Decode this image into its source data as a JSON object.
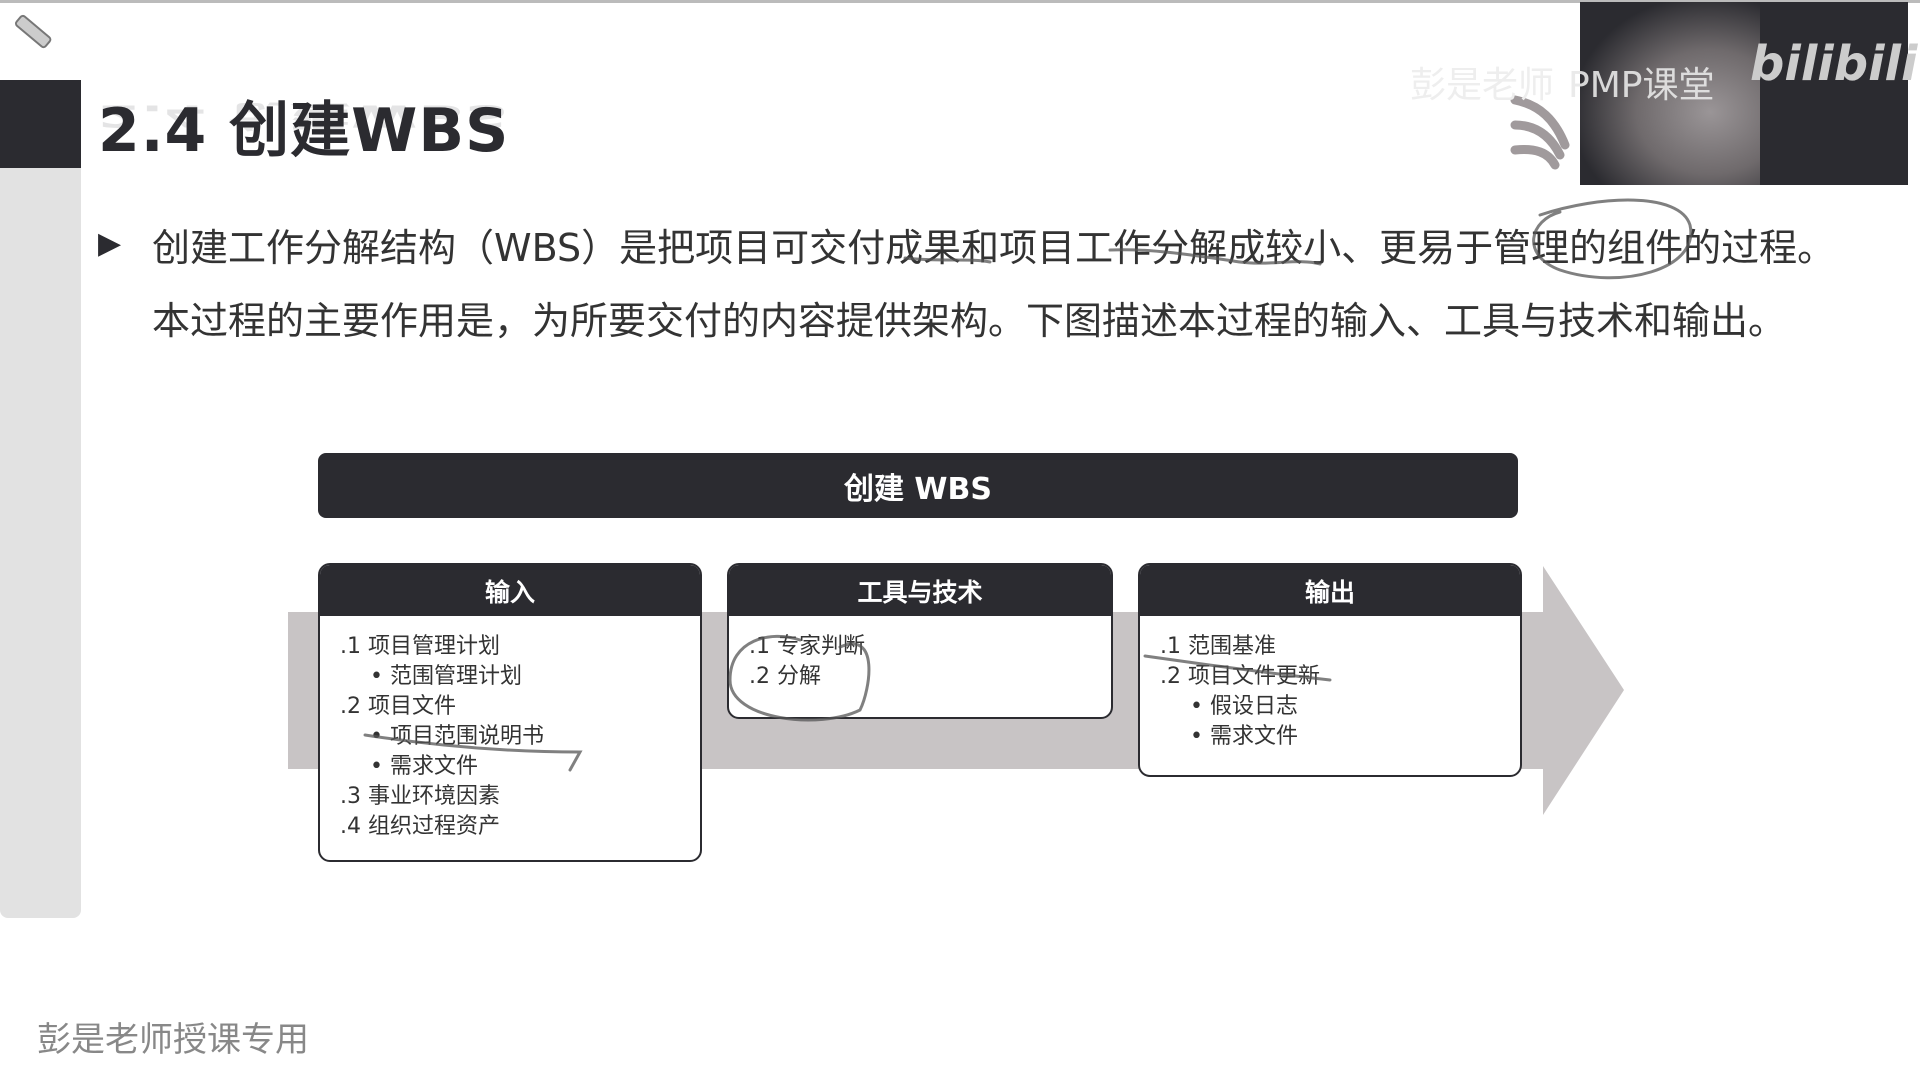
{
  "slide": {
    "title": "2.4 创建WBS",
    "paragraph": "创建工作分解结构（WBS）是把项目可交付成果和项目工作分解成较小、更易于管理的组件的过程。本过程的主要作用是，为所要交付的内容提供架构。下图描述本过程的输入、工具与技术和输出。",
    "bullet_icon": "play-triangle-icon",
    "diagram": {
      "header": "创建 WBS",
      "inputs": {
        "title": "输入",
        "items": [
          {
            "text": ".1 项目管理计划",
            "sub": false
          },
          {
            "text": "范围管理计划",
            "sub": true
          },
          {
            "text": ".2 项目文件",
            "sub": false
          },
          {
            "text": "项目范围说明书",
            "sub": true
          },
          {
            "text": "需求文件",
            "sub": true
          },
          {
            "text": ".3 事业环境因素",
            "sub": false
          },
          {
            "text": ".4 组织过程资产",
            "sub": false
          }
        ]
      },
      "tools": {
        "title": "工具与技术",
        "items": [
          {
            "text": ".1 专家判断",
            "sub": false
          },
          {
            "text": ".2 分解",
            "sub": false
          }
        ]
      },
      "outputs": {
        "title": "输出",
        "items": [
          {
            "text": ".1 范围基准",
            "sub": false
          },
          {
            "text": ".2 项目文件更新",
            "sub": false
          },
          {
            "text": "假设日志",
            "sub": true
          },
          {
            "text": "需求文件",
            "sub": true
          }
        ]
      }
    },
    "footer": "彭是老师授课专用"
  },
  "overlay": {
    "watermark": "PMP课堂",
    "watermark_faded": "彭是老师",
    "platform_logo": "bilibili"
  },
  "colors": {
    "dark": "#2b2b30",
    "arrow": "#c8c4c5",
    "sidebar": "#e2e2e2"
  }
}
